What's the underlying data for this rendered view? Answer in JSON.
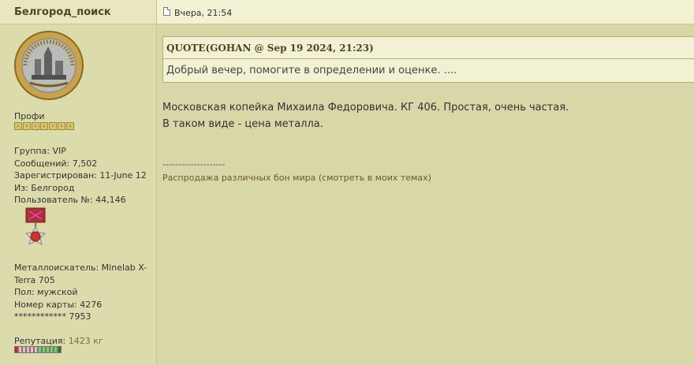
{
  "author": {
    "name": "Белгород_поиск"
  },
  "post": {
    "date": "Вчера, 21:54",
    "quote_header": "QUOTE(GOHAN @ Sep 19 2024, 21:23)",
    "quote_text": "Добрый вечер, помогите в определении и оценке. ....",
    "lines": [
      "Московская копейка Михаила Федоровича. КГ 406. Простая, очень частая.",
      "В таком виде - цена металла."
    ],
    "signature_separator": "--------------------",
    "signature_text": "Распродажа различных бон мира (смотреть в моих темах)"
  },
  "profile": {
    "rank": "Профи",
    "rank_pips": 7,
    "group": "Группа: VIP",
    "messages": "Сообщений: 7,502",
    "registered": "Зарегистрирован: 11-June 12",
    "from": "Из: Белгород",
    "user_no": "Пользователь №: 44,146",
    "detector_line1": "Металлоискатель: Minelab X-",
    "detector_line2": "Terra 705",
    "gender": "Пол: мужской",
    "card": "Номер карты: 4276",
    "card_mask": "************ 7953",
    "rep_label": "Репутация:",
    "rep_value": "1423 кг"
  },
  "colors": {
    "background": "#d8d7a8",
    "header_bg": "#f2f1d4",
    "quote_border": "#b3af6b"
  },
  "icons": [
    "post-icon",
    "avatar-coin",
    "medal-icon",
    "reputation-bar"
  ]
}
